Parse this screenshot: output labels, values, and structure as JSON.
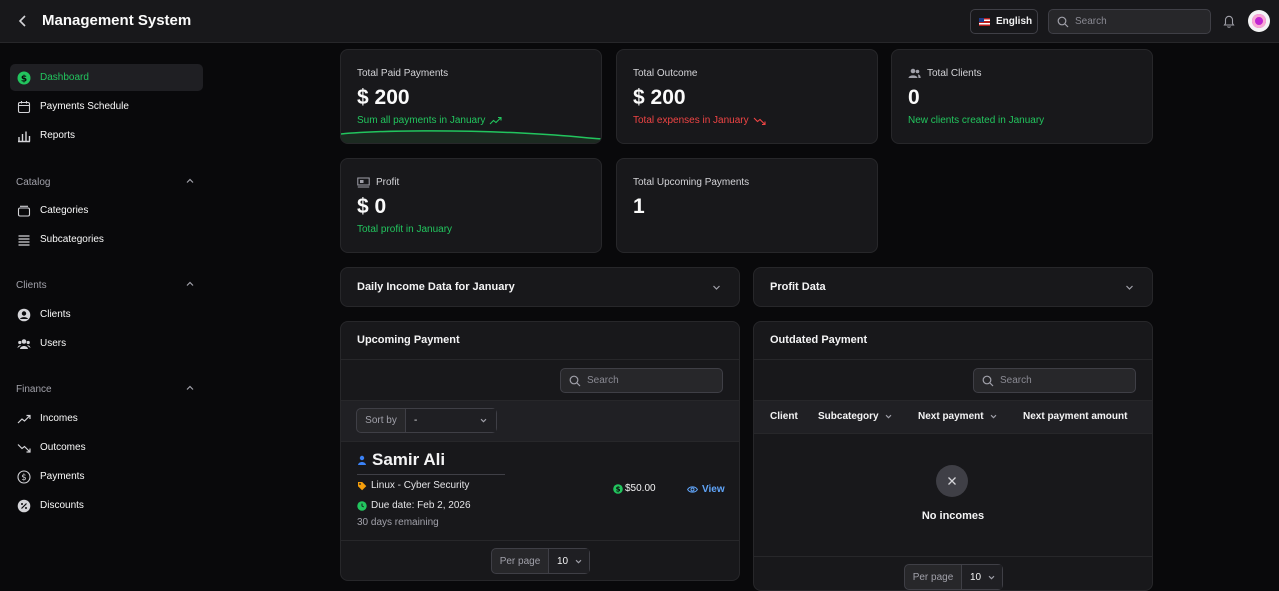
{
  "header": {
    "title": "Management System",
    "language": "English",
    "search_placeholder": "Search"
  },
  "sidebar": {
    "items": [
      {
        "label": "Dashboard",
        "icon": "dollar-circle-icon"
      },
      {
        "label": "Payments Schedule",
        "icon": "calendar-icon"
      },
      {
        "label": "Reports",
        "icon": "bar-chart-icon"
      }
    ],
    "catalog": {
      "label": "Catalog",
      "items": [
        {
          "label": "Categories"
        },
        {
          "label": "Subcategories"
        }
      ]
    },
    "clients": {
      "label": "Clients",
      "items": [
        {
          "label": "Clients"
        },
        {
          "label": "Users"
        }
      ]
    },
    "finance": {
      "label": "Finance",
      "items": [
        {
          "label": "Incomes"
        },
        {
          "label": "Outcomes"
        },
        {
          "label": "Payments"
        },
        {
          "label": "Discounts"
        }
      ]
    }
  },
  "stats": {
    "paid": {
      "label": "Total Paid Payments",
      "value": "$ 200",
      "sub": "Sum all payments in January"
    },
    "outcome": {
      "label": "Total Outcome",
      "value": "$ 200",
      "sub": "Total expenses in January"
    },
    "clients": {
      "label": "Total Clients",
      "value": "0",
      "sub": "New clients created in January"
    },
    "profit": {
      "label": "Profit",
      "value": "$ 0",
      "sub": "Total profit in January"
    },
    "upcoming": {
      "label": "Total Upcoming Payments",
      "value": "1"
    }
  },
  "collapsibles": {
    "daily": "Daily Income Data for January",
    "profit": "Profit Data"
  },
  "upcoming_panel": {
    "title": "Upcoming Payment",
    "search_placeholder": "Search",
    "sort_label": "Sort by",
    "sort_value": "-",
    "payment": {
      "name": "Samir Ali",
      "category": "Linux - Cyber Security",
      "due": "Due date: Feb 2, 2026",
      "remaining": "30 days remaining",
      "amount": "$50.00",
      "view": "View"
    },
    "per_page_label": "Per page",
    "per_page_value": "10"
  },
  "outdated_panel": {
    "title": "Outdated Payment",
    "search_placeholder": "Search",
    "columns": [
      "Client",
      "Subcategory",
      "Next payment",
      "Next payment amount"
    ],
    "empty": "No incomes",
    "per_page_label": "Per page",
    "per_page_value": "10"
  },
  "colors": {
    "accent": "#22c55e",
    "danger": "#ef4444",
    "link": "#60a5fa"
  }
}
